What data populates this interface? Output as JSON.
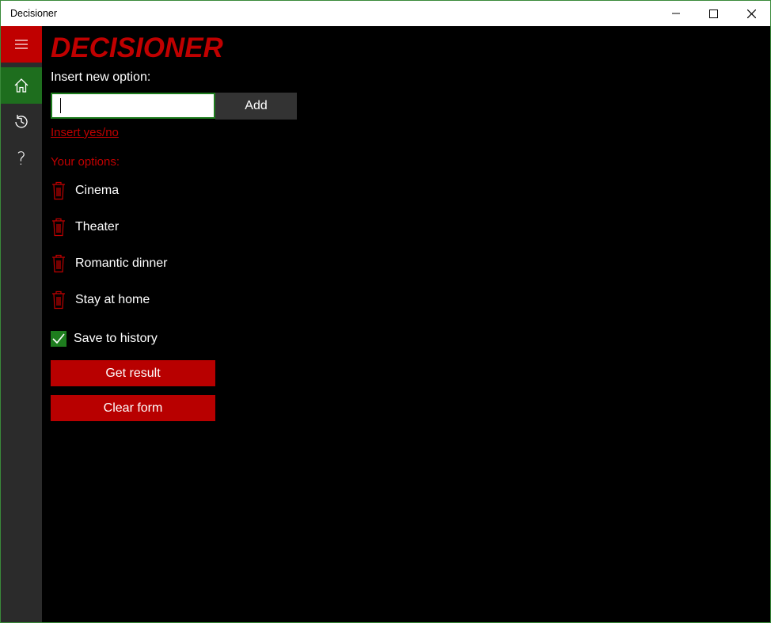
{
  "window": {
    "title": "Decisioner"
  },
  "sidebar": {
    "items": [
      {
        "icon": "hamburger-icon"
      },
      {
        "icon": "home-icon"
      },
      {
        "icon": "history-icon"
      },
      {
        "icon": "help-icon",
        "glyph": "?"
      }
    ]
  },
  "main": {
    "app_title": "DECISIONER",
    "insert_label": "Insert new option:",
    "input_value": "",
    "add_label": "Add",
    "yesno_link": "Insert yes/no",
    "options_label": "Your options:",
    "options": [
      "Cinema",
      "Theater",
      "Romantic dinner",
      "Stay at home"
    ],
    "save_to_history": {
      "label": "Save to history",
      "checked": true
    },
    "get_result_label": "Get result",
    "clear_form_label": "Clear form"
  },
  "colors": {
    "accent_red": "#c00000",
    "accent_green": "#1e7d1e",
    "background": "#000000",
    "sidebar": "#2b2b2b"
  }
}
